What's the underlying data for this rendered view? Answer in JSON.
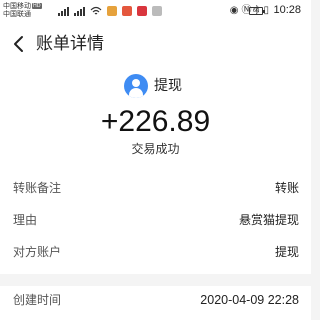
{
  "status_bar": {
    "carrier1": "中国移动",
    "carrier1_badge": "HD",
    "carrier2": "中国联通",
    "battery": "60",
    "time": "10:28"
  },
  "nav": {
    "back_icon": "chevron-left-icon",
    "title": "账单详情"
  },
  "summary": {
    "avatar_icon": "user-icon",
    "type": "提现",
    "amount": "+226.89",
    "status": "交易成功"
  },
  "details": [
    {
      "label": "转账备注",
      "value": "转账"
    },
    {
      "label": "理由",
      "value": "悬赏猫提现"
    },
    {
      "label": "对方账户",
      "value": "提现"
    },
    {
      "label": "创建时间",
      "value": "2020-04-09 22:28"
    }
  ],
  "colors": {
    "accent": "#3f8cf3",
    "background": "#f4f4f4"
  }
}
